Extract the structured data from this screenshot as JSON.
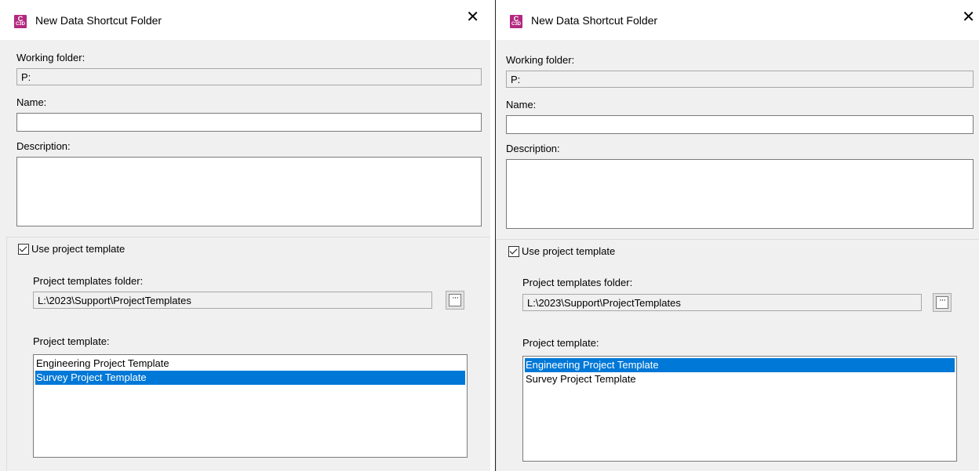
{
  "dialogs": [
    {
      "title": "New Data Shortcut Folder",
      "app_icon": {
        "top": "C",
        "bottom": "C3D"
      },
      "close": "✕",
      "working_folder_label": "Working folder:",
      "working_folder_value": "P:",
      "name_label": "Name:",
      "name_value": "",
      "description_label": "Description:",
      "description_value": "",
      "use_template_label": "Use project template",
      "use_template_checked": true,
      "templates_folder_label": "Project templates folder:",
      "templates_folder_value": "L:\\2023\\Support\\ProjectTemplates",
      "browse_label": "···",
      "project_template_label": "Project template:",
      "templates": [
        "Engineering Project Template",
        "Survey Project Template"
      ],
      "selected_template": "Survey Project Template"
    },
    {
      "title": "New Data Shortcut Folder",
      "app_icon": {
        "top": "C",
        "bottom": "C3D"
      },
      "close": "✕",
      "working_folder_label": "Working folder:",
      "working_folder_value": "P:",
      "name_label": "Name:",
      "name_value": "",
      "description_label": "Description:",
      "description_value": "",
      "use_template_label": "Use project template",
      "use_template_checked": true,
      "templates_folder_label": "Project templates folder:",
      "templates_folder_value": "L:\\2023\\Support\\ProjectTemplates",
      "browse_label": "···",
      "project_template_label": "Project template:",
      "templates": [
        "Engineering Project Template",
        "Survey Project Template"
      ],
      "selected_template": "Engineering Project Template"
    }
  ],
  "colors": {
    "selection": "#0078d7",
    "dialog_bg": "#f0f0f0",
    "icon_brand": "#b3287f"
  }
}
